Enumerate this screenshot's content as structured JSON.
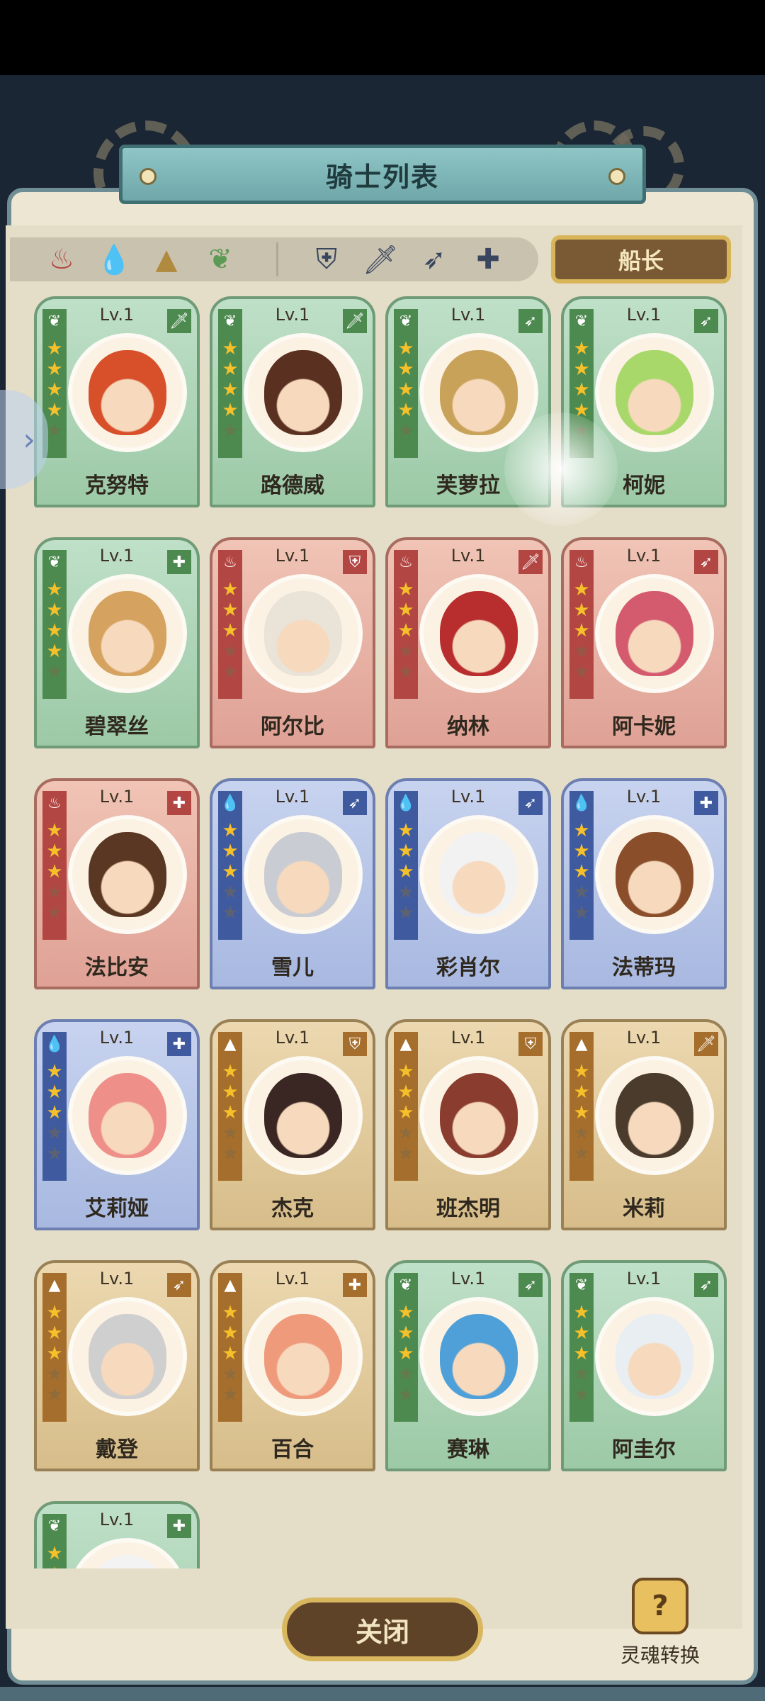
{
  "title": "骑士列表",
  "captain_label": "船长",
  "close_label": "关闭",
  "soul_convert_label": "灵魂转换",
  "element_filters": [
    "fire",
    "water",
    "earth",
    "nature"
  ],
  "class_filters": [
    "shield",
    "sword",
    "bow",
    "support"
  ],
  "colors": {
    "nature": "#6f9b77",
    "fire": "#a86b60",
    "water": "#6d7fb0",
    "earth": "#9a8155",
    "accent": "#d8b75e"
  },
  "knights": [
    {
      "name": "克努特",
      "level": "Lv.1",
      "element": "nature",
      "class": "sword",
      "stars": 4,
      "hair": "#d8502a"
    },
    {
      "name": "路德威",
      "level": "Lv.1",
      "element": "nature",
      "class": "sword",
      "stars": 4,
      "hair": "#5a3120"
    },
    {
      "name": "芙萝拉",
      "level": "Lv.1",
      "element": "nature",
      "class": "bow",
      "stars": 4,
      "hair": "#c9a25a"
    },
    {
      "name": "柯妮",
      "level": "Lv.1",
      "element": "nature",
      "class": "bow",
      "stars": 4,
      "hair": "#a9d86a"
    },
    {
      "name": "碧翠丝",
      "level": "Lv.1",
      "element": "nature",
      "class": "support",
      "stars": 4,
      "hair": "#d6a25f"
    },
    {
      "name": "阿尔比",
      "level": "Lv.1",
      "element": "fire",
      "class": "shield",
      "stars": 3,
      "hair": "#e9e3d8"
    },
    {
      "name": "纳林",
      "level": "Lv.1",
      "element": "fire",
      "class": "sword",
      "stars": 3,
      "hair": "#b82d2d"
    },
    {
      "name": "阿卡妮",
      "level": "Lv.1",
      "element": "fire",
      "class": "bow",
      "stars": 3,
      "hair": "#d45a6e"
    },
    {
      "name": "法比安",
      "level": "Lv.1",
      "element": "fire",
      "class": "support",
      "stars": 3,
      "hair": "#5a3722"
    },
    {
      "name": "雪儿",
      "level": "Lv.1",
      "element": "water",
      "class": "bow",
      "stars": 3,
      "hair": "#c9ccd2"
    },
    {
      "name": "彩肖尔",
      "level": "Lv.1",
      "element": "water",
      "class": "bow",
      "stars": 3,
      "hair": "#f2f2f2"
    },
    {
      "name": "法蒂玛",
      "level": "Lv.1",
      "element": "water",
      "class": "support",
      "stars": 3,
      "hair": "#8a4f2a"
    },
    {
      "name": "艾莉娅",
      "level": "Lv.1",
      "element": "water",
      "class": "support",
      "stars": 3,
      "hair": "#ee8f8a"
    },
    {
      "name": "杰克",
      "level": "Lv.1",
      "element": "earth",
      "class": "shield",
      "stars": 3,
      "hair": "#3a2622"
    },
    {
      "name": "班杰明",
      "level": "Lv.1",
      "element": "earth",
      "class": "shield",
      "stars": 3,
      "hair": "#8a3d2e"
    },
    {
      "name": "米莉",
      "level": "Lv.1",
      "element": "earth",
      "class": "sword",
      "stars": 3,
      "hair": "#4a3b2c"
    },
    {
      "name": "戴登",
      "level": "Lv.1",
      "element": "earth",
      "class": "bow",
      "stars": 3,
      "hair": "#cfcfcf"
    },
    {
      "name": "百合",
      "level": "Lv.1",
      "element": "earth",
      "class": "support",
      "stars": 3,
      "hair": "#ef9a7a"
    },
    {
      "name": "赛琳",
      "level": "Lv.1",
      "element": "nature",
      "class": "bow",
      "stars": 3,
      "hair": "#4fa0d8"
    },
    {
      "name": "阿圭尔",
      "level": "Lv.1",
      "element": "nature",
      "class": "bow",
      "stars": 3,
      "hair": "#e8eef2"
    },
    {
      "name": "",
      "level": "Lv.1",
      "element": "nature",
      "class": "support",
      "stars": 3,
      "hair": "#f3f3f3"
    }
  ]
}
